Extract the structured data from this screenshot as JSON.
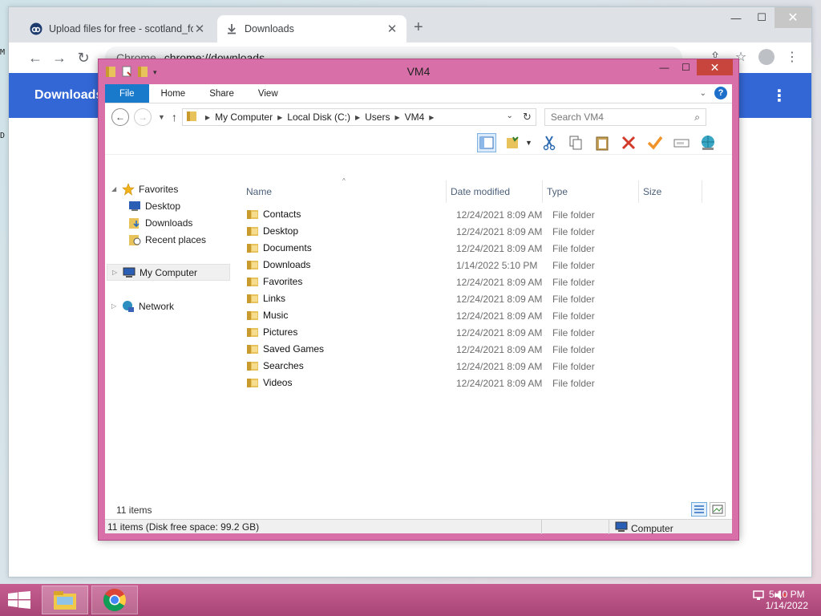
{
  "browser": {
    "tabs": [
      {
        "label": "Upload files for free - scotland_fo"
      },
      {
        "label": "Downloads"
      }
    ],
    "new_tab": "+",
    "window": {
      "minimize": "—",
      "maximize": "☐",
      "close": "✕"
    },
    "omnibox": {
      "scheme": "Chrome",
      "url": "chrome://downloads"
    },
    "page_header": "Downloads"
  },
  "explorer": {
    "title": "VM4",
    "ribbon_tabs": [
      "File",
      "Home",
      "Share",
      "View"
    ],
    "breadcrumb": [
      "My Computer",
      "Local Disk (C:)",
      "Users",
      "VM4"
    ],
    "search_placeholder": "Search VM4",
    "nav_pane": {
      "favorites": "Favorites",
      "favorites_items": [
        "Desktop",
        "Downloads",
        "Recent places"
      ],
      "computer": "My Computer",
      "network": "Network"
    },
    "columns": {
      "name": "Name",
      "date": "Date modified",
      "type": "Type",
      "size": "Size"
    },
    "files": [
      {
        "name": "Contacts",
        "date": "12/24/2021 8:09 AM",
        "type": "File folder"
      },
      {
        "name": "Desktop",
        "date": "12/24/2021 8:09 AM",
        "type": "File folder"
      },
      {
        "name": "Documents",
        "date": "12/24/2021 8:09 AM",
        "type": "File folder"
      },
      {
        "name": "Downloads",
        "date": "1/14/2022 5:10 PM",
        "type": "File folder"
      },
      {
        "name": "Favorites",
        "date": "12/24/2021 8:09 AM",
        "type": "File folder"
      },
      {
        "name": "Links",
        "date": "12/24/2021 8:09 AM",
        "type": "File folder"
      },
      {
        "name": "Music",
        "date": "12/24/2021 8:09 AM",
        "type": "File folder"
      },
      {
        "name": "Pictures",
        "date": "12/24/2021 8:09 AM",
        "type": "File folder"
      },
      {
        "name": "Saved Games",
        "date": "12/24/2021 8:09 AM",
        "type": "File folder"
      },
      {
        "name": "Searches",
        "date": "12/24/2021 8:09 AM",
        "type": "File folder"
      },
      {
        "name": "Videos",
        "date": "12/24/2021 8:09 AM",
        "type": "File folder"
      }
    ],
    "item_count": "11 items",
    "status_left": "11 items (Disk free space: 99.2 GB)",
    "status_right": "Computer"
  },
  "taskbar": {
    "time": "5:10 PM",
    "date": "1/14/2022"
  },
  "colors": {
    "window_frame": "#d86fa9",
    "taskbar": "#b94f84",
    "chrome_header": "#3367d6",
    "file_tab": "#1979ca"
  }
}
